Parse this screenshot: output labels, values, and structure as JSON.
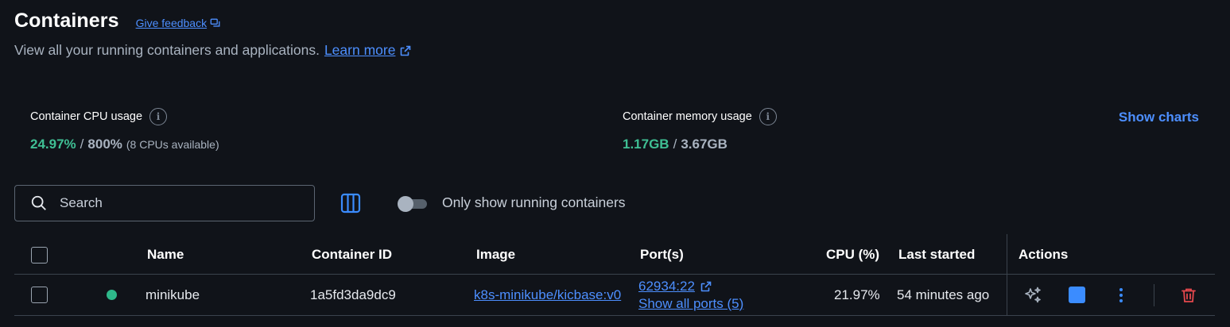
{
  "header": {
    "title": "Containers",
    "feedback_label": "Give feedback",
    "subtitle": "View all your running containers and applications.",
    "learn_more": "Learn more"
  },
  "stats": {
    "cpu": {
      "label": "Container CPU usage",
      "value": "24.97%",
      "separator": "/",
      "total": "800%",
      "note": "(8 CPUs available)"
    },
    "memory": {
      "label": "Container memory usage",
      "value": "1.17GB",
      "separator": "/",
      "total": "3.67GB"
    },
    "show_charts": "Show charts"
  },
  "toolbar": {
    "search_placeholder": "Search",
    "toggle_label": "Only show running containers",
    "toggle_on": false
  },
  "table": {
    "columns": [
      "Name",
      "Container ID",
      "Image",
      "Port(s)",
      "CPU (%)",
      "Last started",
      "Actions"
    ],
    "rows": [
      {
        "status": "running",
        "name": "minikube",
        "container_id": "1a5fd3da9dc9",
        "image": "k8s-minikube/kicbase:v0",
        "port": "62934:22",
        "show_ports": "Show all ports (5)",
        "cpu": "21.97%",
        "last_started": "54 minutes ago"
      }
    ]
  },
  "colors": {
    "background": "#101319",
    "accent": "#4d8fff",
    "green": "#3fbf94",
    "danger": "#e5484d"
  }
}
